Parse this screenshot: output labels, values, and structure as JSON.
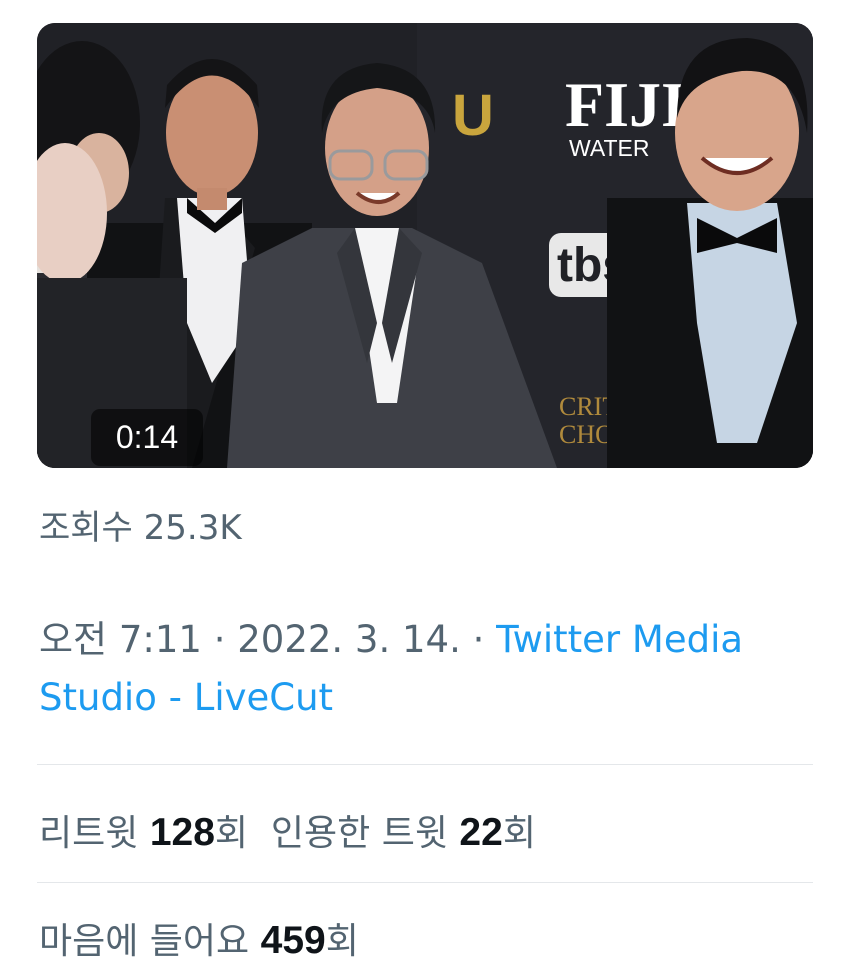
{
  "video": {
    "duration": "0:14",
    "backdrop_logos": {
      "fiji_top": "FIJI",
      "fiji_bottom": "WATER",
      "tbs": "tbs",
      "cw": "U",
      "awards_line1": "CRIT",
      "awards_line2": "CHOI"
    }
  },
  "tweet": {
    "views_label": "조회수",
    "views_value": "25.3K",
    "time": "오전 7:11",
    "separator": "·",
    "date": "2022. 3. 14.",
    "source": "Twitter Media Studio - LiveCut"
  },
  "stats": {
    "retweets_label": "리트윗",
    "retweets_value": "128",
    "retweets_suffix": "회",
    "quotes_label": "인용한 트윗",
    "quotes_value": "22",
    "quotes_suffix": "회",
    "likes_label": "마음에 들어요",
    "likes_value": "459",
    "likes_suffix": "회"
  }
}
